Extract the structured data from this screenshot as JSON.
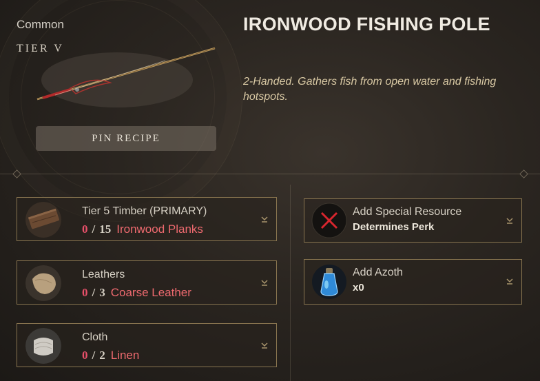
{
  "item": {
    "rarity": "Common",
    "tier": "TIER V",
    "name": "IRONWOOD FISHING POLE",
    "description": "2-Handed. Gathers fish from open water and fishing hotspots.",
    "pin_label": "PIN RECIPE"
  },
  "ingredients": [
    {
      "category": "Tier 5 Timber (PRIMARY)",
      "have": "0",
      "need": "15",
      "resource": "Ironwood Planks",
      "icon": "ironwood-planks-icon"
    },
    {
      "category": "Leathers",
      "have": "0",
      "need": "3",
      "resource": "Coarse Leather",
      "icon": "coarse-leather-icon"
    },
    {
      "category": "Cloth",
      "have": "0",
      "need": "2",
      "resource": "Linen",
      "icon": "linen-icon"
    }
  ],
  "extras": [
    {
      "title": "Add Special Resource",
      "subtitle": "Determines Perk",
      "icon": "empty-slot-x-icon"
    },
    {
      "title": "Add Azoth",
      "subtitle": "x0",
      "icon": "azoth-flask-icon"
    }
  ],
  "colors": {
    "missing_quantity": "#e8506a",
    "resource_name": "#ee6a6f",
    "slot_border": "#8a7650",
    "description": "#d9c9a4"
  }
}
